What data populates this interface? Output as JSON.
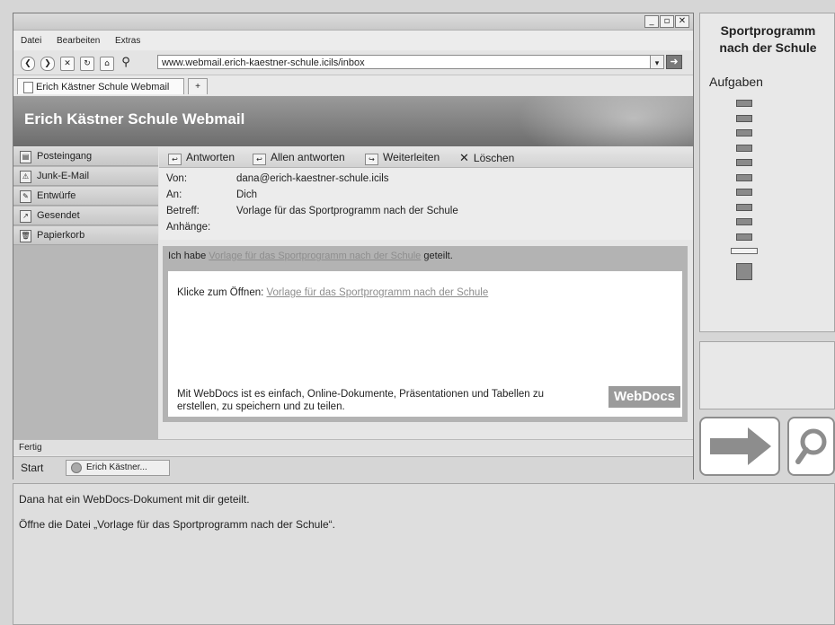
{
  "browser": {
    "window_controls": [
      "_",
      "▫",
      "✕"
    ],
    "menu": [
      "Datei",
      "Bearbeiten",
      "Extras"
    ],
    "url": "www.webmail.erich-kaestner-schule.icils/inbox",
    "tab_title": "Erich Kästner Schule Webmail",
    "new_tab_label": "+",
    "status": "Fertig"
  },
  "webmail": {
    "title": "Erich Kästner Schule Webmail",
    "folders": [
      {
        "label": "Posteingang",
        "icon": "inbox-icon"
      },
      {
        "label": "Junk-E-Mail",
        "icon": "junk-icon"
      },
      {
        "label": "Entwürfe",
        "icon": "drafts-icon"
      },
      {
        "label": "Gesendet",
        "icon": "sent-icon"
      },
      {
        "label": "Papierkorb",
        "icon": "trash-icon"
      }
    ],
    "toolbar": {
      "reply": "Antworten",
      "reply_all": "Allen antworten",
      "forward": "Weiterleiten",
      "delete": "Löschen"
    },
    "headers": {
      "from_label": "Von:",
      "from": "dana@erich-kaestner-schule.icils",
      "to_label": "An:",
      "to": "Dich",
      "subject_label": "Betreff:",
      "subject": "Vorlage für das Sportprogramm nach der Schule",
      "attachments_label": "Anhänge:"
    },
    "message": {
      "shared_prefix": "Ich habe ",
      "shared_link": "Vorlage für das Sportprogramm nach der Schule",
      "shared_suffix": " geteilt.",
      "open_prefix": "Klicke zum Öffnen: ",
      "open_link": "Vorlage für das Sportprogramm nach der Schule",
      "info": "Mit WebDocs ist es einfach, Online-Dokumente, Präsentationen und Tabellen zu erstellen, zu speichern und zu teilen.",
      "badge": "WebDocs"
    }
  },
  "taskbar": {
    "start": "Start",
    "item": "Erich Kästner..."
  },
  "panel": {
    "title_line1": "Sportprogramm",
    "title_line2": "nach der Schule",
    "tasks_label": "Aufgaben",
    "tasks_total": 12,
    "current_task": 11
  },
  "instructions": {
    "line1": "Dana hat ein WebDocs-Dokument mit dir geteilt.",
    "line2": "Öffne die Datei „Vorlage für das Sportprogramm nach der Schule“."
  },
  "colors": {
    "banner": "#7d7d7d",
    "sidebar": "#b7b7b7",
    "link": "#8d8d8d",
    "arrow": "#8d8d8d"
  }
}
